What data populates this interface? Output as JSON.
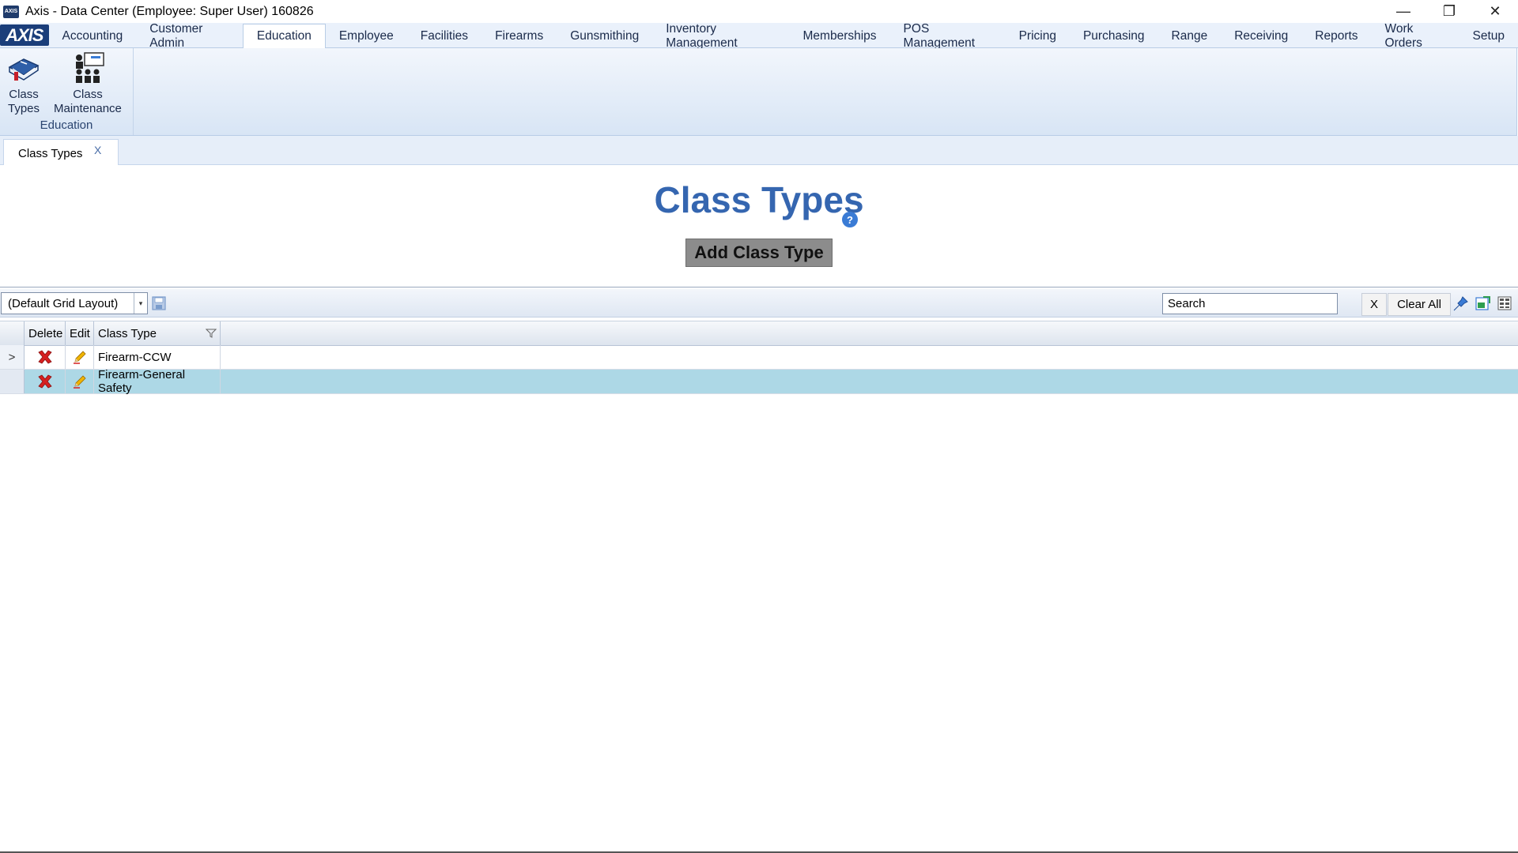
{
  "window": {
    "title": "Axis - Data Center  (Employee: Super User) 160826",
    "app_icon_text": "AXIS",
    "minimize": "—",
    "restore": "❐",
    "close": "✕"
  },
  "menu": {
    "logo": "AXIS",
    "tabs": [
      {
        "label": "Accounting"
      },
      {
        "label": "Customer Admin"
      },
      {
        "label": "Education"
      },
      {
        "label": "Employee"
      },
      {
        "label": "Facilities"
      },
      {
        "label": "Firearms"
      },
      {
        "label": "Gunsmithing"
      },
      {
        "label": "Inventory Management"
      },
      {
        "label": "Memberships"
      },
      {
        "label": "POS Management"
      },
      {
        "label": "Pricing"
      },
      {
        "label": "Purchasing"
      },
      {
        "label": "Range"
      },
      {
        "label": "Receiving"
      },
      {
        "label": "Reports"
      },
      {
        "label": "Work Orders"
      },
      {
        "label": "Setup"
      }
    ],
    "active_tab": "Education"
  },
  "ribbon": {
    "group_label": "Education",
    "buttons": [
      {
        "line1": "Class",
        "line2": "Types",
        "icon": "book-icon"
      },
      {
        "line1": "Class",
        "line2": "Maintenance",
        "icon": "classroom-icon"
      }
    ]
  },
  "doc_tabs": [
    {
      "label": "Class Types",
      "close": "X"
    }
  ],
  "page": {
    "title": "Class Types",
    "help": "?",
    "add_button": "Add Class Type"
  },
  "grid_toolbar": {
    "layout_value": "(Default Grid Layout)",
    "dropdown_arrow": "▾",
    "search_placeholder": "Search",
    "search_clear": "X",
    "clear_all": "Clear All"
  },
  "grid": {
    "columns": [
      "Delete",
      "Edit",
      "Class Type"
    ],
    "rows": [
      {
        "indicator": ">",
        "class_type": "Firearm-CCW",
        "selected": false
      },
      {
        "indicator": "",
        "class_type": "Firearm-General Safety",
        "selected": true
      }
    ]
  },
  "colors": {
    "accent": "#3566b0",
    "selected_row": "#add8e6",
    "delete_red": "#d62020",
    "edit_yellow": "#f0b400"
  }
}
